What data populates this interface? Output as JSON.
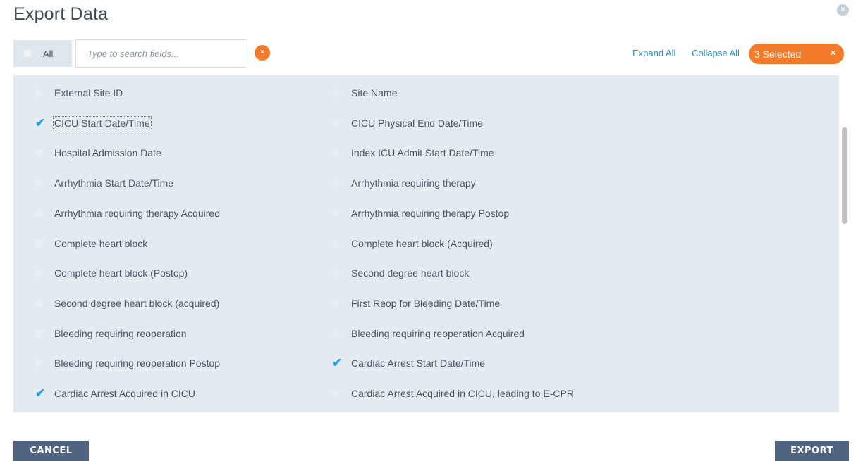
{
  "dialog": {
    "title": "Export Data",
    "close_icon": "×"
  },
  "toolbar": {
    "all_label": "All",
    "search_placeholder": "Type to search fields...",
    "search_clear_icon": "×",
    "expand_all": "Expand All",
    "collapse_all": "Collapse All",
    "selected_label": "3 Selected",
    "selected_clear_icon": "×"
  },
  "fields": [
    {
      "label": "External Site ID",
      "checked": false
    },
    {
      "label": "Site Name",
      "checked": false
    },
    {
      "label": "CICU Start Date/Time",
      "checked": true,
      "focused": true
    },
    {
      "label": "CICU Physical End Date/Time",
      "checked": false
    },
    {
      "label": "Hospital Admission Date",
      "checked": false
    },
    {
      "label": "Index ICU Admit Start Date/Time",
      "checked": false
    },
    {
      "label": "Arrhythmia Start Date/Time",
      "checked": false
    },
    {
      "label": "Arrhythmia requiring therapy",
      "checked": false
    },
    {
      "label": "Arrhythmia requiring therapy Acquired",
      "checked": false
    },
    {
      "label": "Arrhythmia requiring therapy Postop",
      "checked": false
    },
    {
      "label": "Complete heart block",
      "checked": false
    },
    {
      "label": "Complete heart block (Acquired)",
      "checked": false
    },
    {
      "label": "Complete heart block (Postop)",
      "checked": false
    },
    {
      "label": "Second degree heart block",
      "checked": false
    },
    {
      "label": "Second degree heart block (acquired)",
      "checked": false
    },
    {
      "label": "First Reop for Bleeding Date/Time",
      "checked": false
    },
    {
      "label": "Bleeding requiring reoperation",
      "checked": false
    },
    {
      "label": "Bleeding requiring reoperation Acquired",
      "checked": false
    },
    {
      "label": "Bleeding requiring reoperation Postop",
      "checked": false
    },
    {
      "label": "Cardiac Arrest Start Date/Time",
      "checked": true
    },
    {
      "label": "Cardiac Arrest Acquired in CICU",
      "checked": true
    },
    {
      "label": "Cardiac Arrest Acquired in CICU, leading to E-CPR",
      "checked": false
    }
  ],
  "check_icon": "✔",
  "footer": {
    "cancel": "CANCEL",
    "export": "EXPORT"
  },
  "colors": {
    "accent": "#f47b2a",
    "link": "#1f8fd6",
    "check": "#2aa3e3",
    "button": "#4f6480",
    "panel": "#e4ebf0"
  }
}
